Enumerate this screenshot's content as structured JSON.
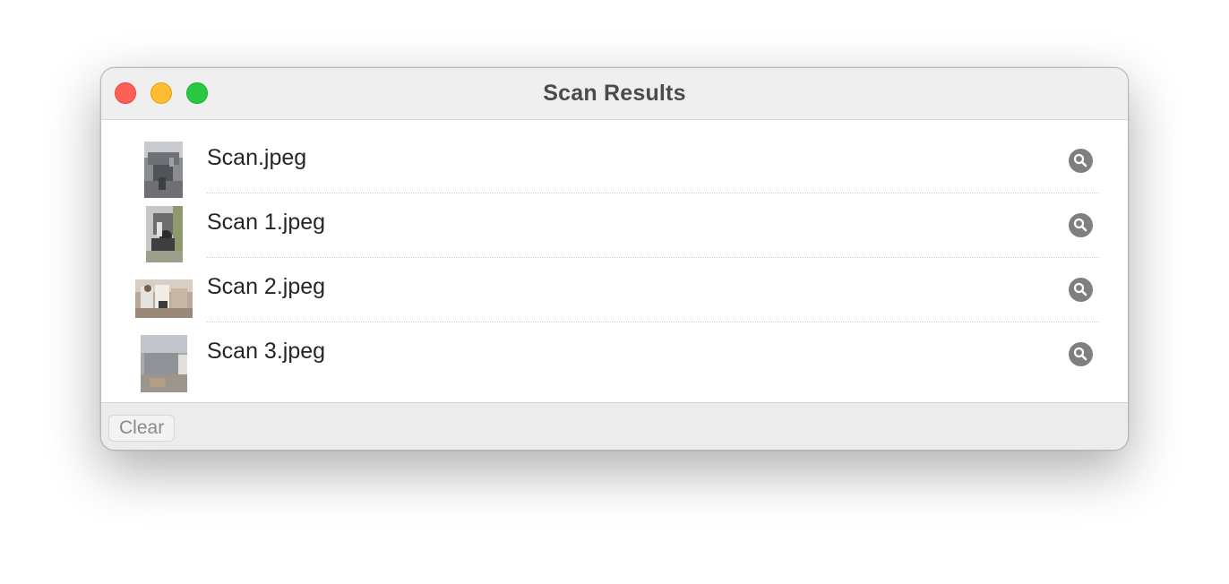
{
  "window": {
    "title": "Scan Results"
  },
  "files": [
    {
      "name": "Scan.jpeg"
    },
    {
      "name": "Scan 1.jpeg"
    },
    {
      "name": "Scan 2.jpeg"
    },
    {
      "name": "Scan 3.jpeg"
    }
  ],
  "footer": {
    "clear_label": "Clear"
  },
  "colors": {
    "close": "#fe5f57",
    "minimize": "#febc2e",
    "zoom": "#28c840",
    "search_icon": "#7f7f7f"
  },
  "icons": {
    "row_action": "magnifying-glass-icon"
  }
}
